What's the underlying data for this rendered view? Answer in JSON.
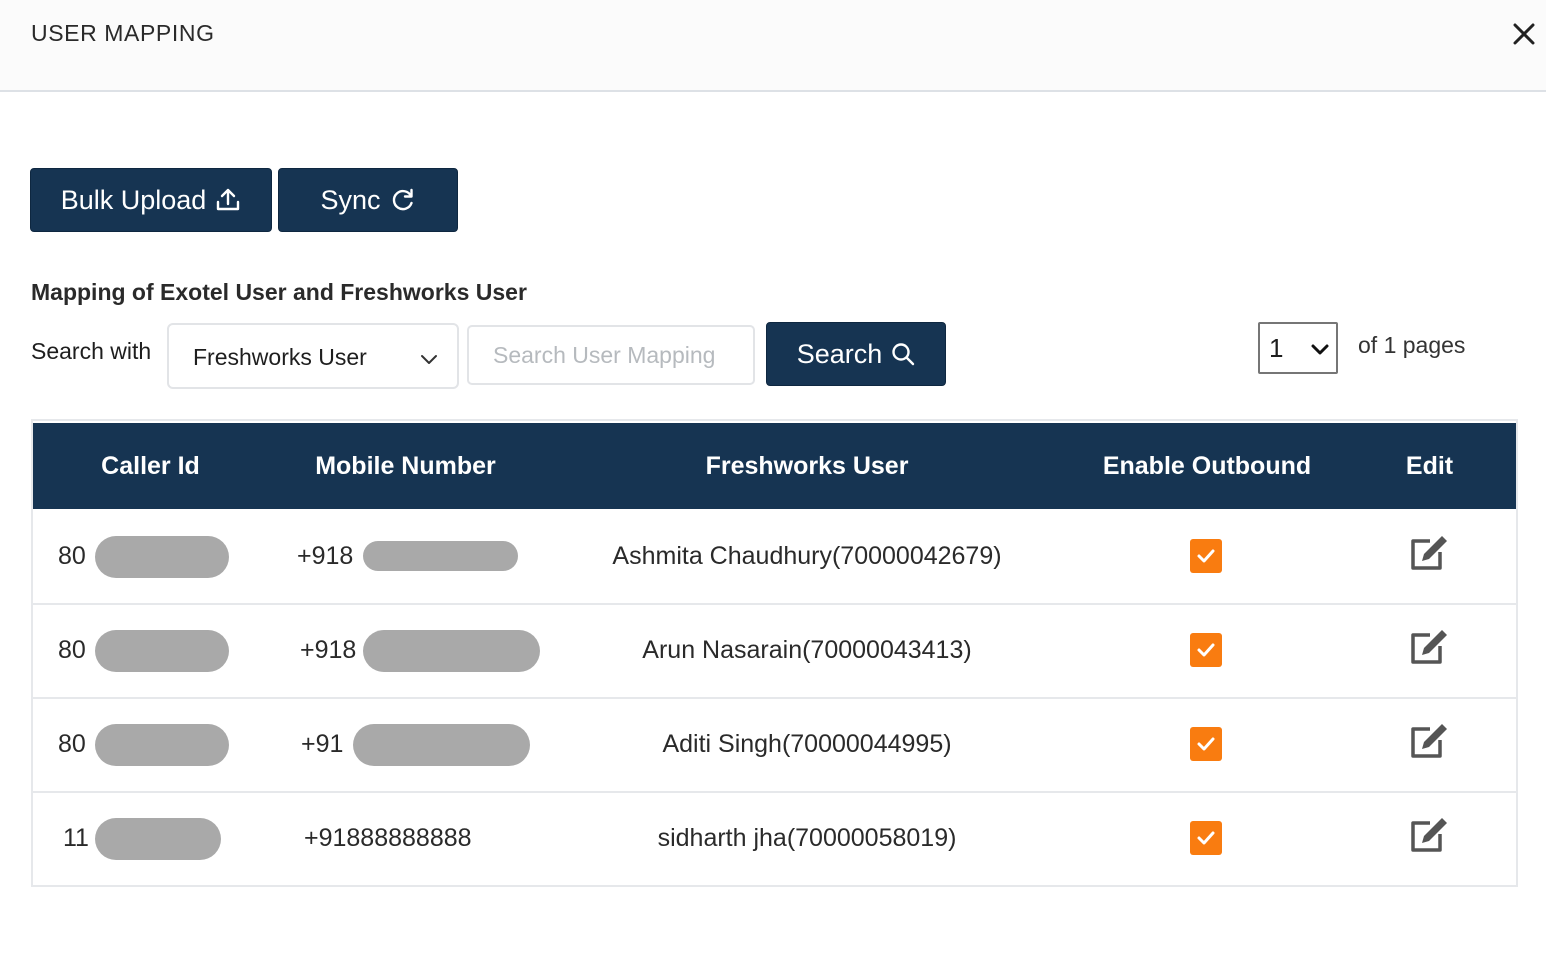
{
  "dialog": {
    "title": "USER MAPPING",
    "close_icon": "close-icon"
  },
  "toolbar": {
    "bulk_upload_label": "Bulk Upload",
    "bulk_upload_icon": "upload-icon",
    "sync_label": "Sync",
    "sync_icon": "refresh-icon"
  },
  "section": {
    "title": "Mapping of Exotel User and Freshworks User"
  },
  "search": {
    "label": "Search with",
    "field_selected": "Freshworks User",
    "input_value": "",
    "placeholder": "Search User Mapping",
    "button_label": "Search",
    "button_icon": "search-icon"
  },
  "pagination": {
    "current_page": "1",
    "of_text": "of 1 pages"
  },
  "table": {
    "columns": [
      "Caller Id",
      "Mobile Number",
      "Freshworks User",
      "Enable Outbound",
      "Edit"
    ],
    "rows": [
      {
        "caller_id": "80",
        "mobile": "+918",
        "freshworks_user": "Ashmita Chaudhury(70000042679)",
        "enable_outbound": true
      },
      {
        "caller_id": "80",
        "mobile": "+918",
        "freshworks_user": "Arun Nasarain(70000043413)",
        "enable_outbound": true
      },
      {
        "caller_id": "80",
        "mobile": "+91",
        "freshworks_user": "Aditi Singh(70000044995)",
        "enable_outbound": true
      },
      {
        "caller_id": "11",
        "mobile": "+91888888888",
        "freshworks_user": "sidharth jha(70000058019)",
        "enable_outbound": true
      }
    ]
  },
  "colors": {
    "primary": "#163452",
    "checkbox": "#f97c10",
    "redaction": "#a9a9a9"
  }
}
